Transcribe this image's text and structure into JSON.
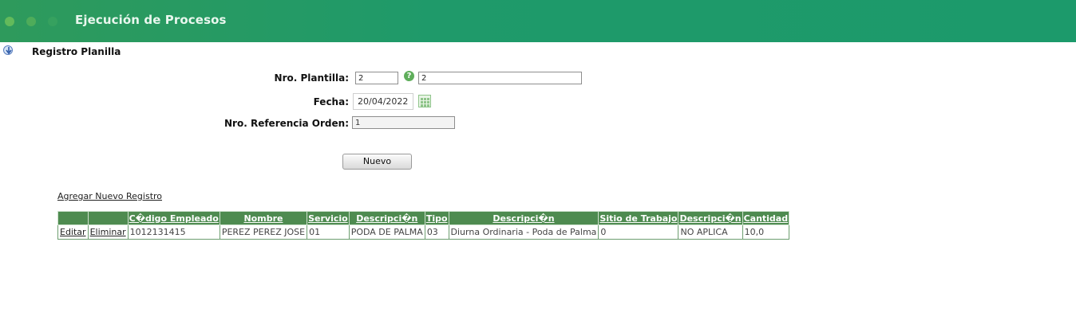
{
  "header": {
    "title": "Ejecución de Procesos"
  },
  "section": {
    "title": "Registro Planilla"
  },
  "form": {
    "plantilla_label": "Nro. Plantilla:",
    "plantilla_code": "2",
    "plantilla_desc": "2",
    "fecha_label": "Fecha:",
    "fecha_value": "20/04/2022",
    "referencia_label": "Nro. Referencia Orden:",
    "referencia_value": "1",
    "nuevo_button": "Nuevo"
  },
  "add_link": "Agregar Nuevo Registro",
  "table": {
    "headers": [
      "",
      "",
      "C�digo Empleado",
      "Nombre",
      "Servicio",
      "Descripci�n",
      "Tipo",
      "Descripci�n",
      "Sitio de Trabajo",
      "Descripci�n",
      "Cantidad"
    ],
    "rows": [
      {
        "edit": "Editar",
        "delete": "Eliminar",
        "codigo": "1012131415",
        "nombre": "PEREZ PEREZ JOSE",
        "servicio": "01",
        "desc_servicio": "PODA DE PALMA",
        "tipo": "03",
        "desc_tipo": "Diurna Ordinaria - Poda de Palma",
        "sitio": "0",
        "desc_sitio": "NO APLICA",
        "cantidad": "10,0"
      }
    ]
  }
}
